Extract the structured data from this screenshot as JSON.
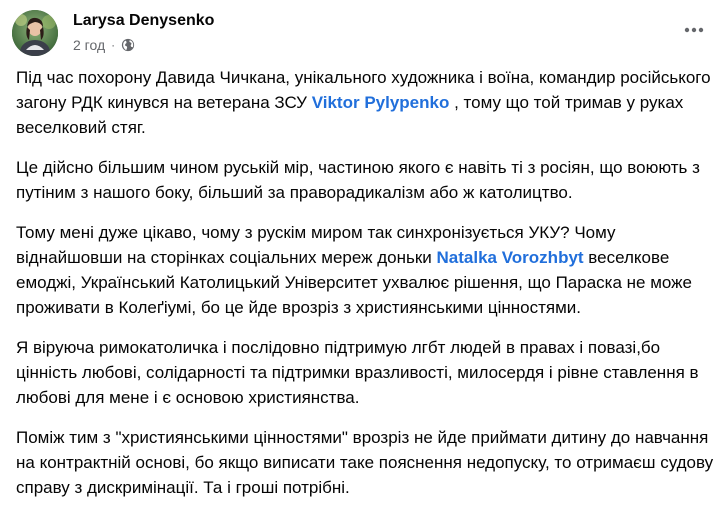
{
  "post": {
    "author": "Larysa Denysenko",
    "time": "2 год",
    "separator": "·",
    "visibility_icon": "globe-icon",
    "more_icon": "ellipsis-icon",
    "paragraphs": [
      {
        "before": "Під час похорону Давида Чичкана, унікального художника і воїна, командир російського загону РДК кинувся на ветерана ЗСУ ",
        "mention": "Viktor Pylypenko",
        "after": " , тому що той тримав у руках веселковий стяг."
      },
      {
        "text": "Це дійсно більшим чином руській мір, частиною якого є навіть ті з росіян, що воюють з путіним з нашого боку, більший за праворадикалізм або ж католицтво."
      },
      {
        "before": "Тому мені дуже цікаво, чому з рускім миром так синхронізується УКУ? Чому віднайшовши на сторінках соціальних мереж доньки ",
        "mention": "Natalka Vorozhbyt",
        "after": " веселкове емоджі, Український Католицький Університет ухвалює рішення, що Параска не може проживати в Колеґіумі, бо це йде врозріз з християнськими цінностями."
      },
      {
        "text": "Я віруюча римокатоличка і послідовно підтримую лгбт людей в правах і повазі,бо цінність любові, солідарності та підтримки вразливості, милосердя і рівне ставлення в любові для мене і є основою християнства."
      },
      {
        "text": "Поміж тим з \"християнськими цінностями\" врозріз не йде приймати дитину до навчання на контрактній основі, бо якщо виписати таке пояснення недопуску, то отримаєш судову справу з дискримінації. Та і гроші потрібні."
      }
    ]
  },
  "colors": {
    "text": "#050505",
    "secondary": "#65676b",
    "mention": "#216fdb"
  }
}
